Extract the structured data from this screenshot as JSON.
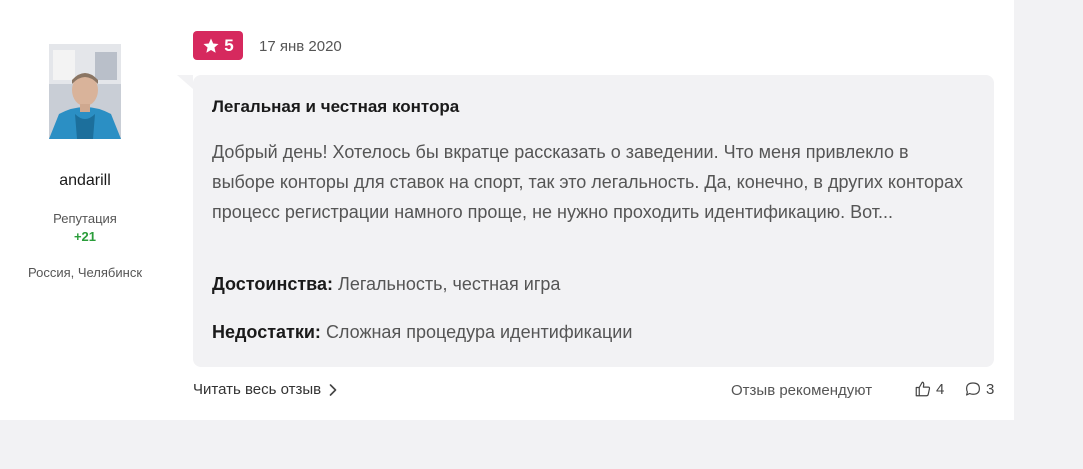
{
  "author": {
    "name": "andarill",
    "reputation_label": "Репутация",
    "reputation_value": "+21",
    "location": "Россия, Челябинск"
  },
  "review": {
    "rating": "5",
    "date": "17 янв 2020",
    "title": "Легальная и честная контора",
    "text": "Добрый день! Хотелось бы вкратце рассказать о заведении. Что меня привлекло в выборе конторы для ставок на спорт, так это легальность. Да, конечно, в других конторах процесс регистрации намного проще, не нужно проходить идентификацию. Вот...",
    "pros_label": "Достоинства:",
    "pros_value": "Легальность, честная игра",
    "cons_label": "Недостатки:",
    "cons_value": "Сложная процедура идентификации"
  },
  "footer": {
    "read_more": "Читать весь отзыв",
    "recommend_label": "Отзыв рекомендуют",
    "likes_count": "4",
    "comments_count": "3"
  },
  "colors": {
    "rating_badge": "#d6295e",
    "reputation_positive": "#2a9d3a",
    "review_box": "#f2f2f4"
  },
  "icons": {
    "rating": "star-icon",
    "read_more": "chevron-right-icon",
    "likes": "thumbs-up-icon",
    "comments": "comment-bubble-icon"
  }
}
